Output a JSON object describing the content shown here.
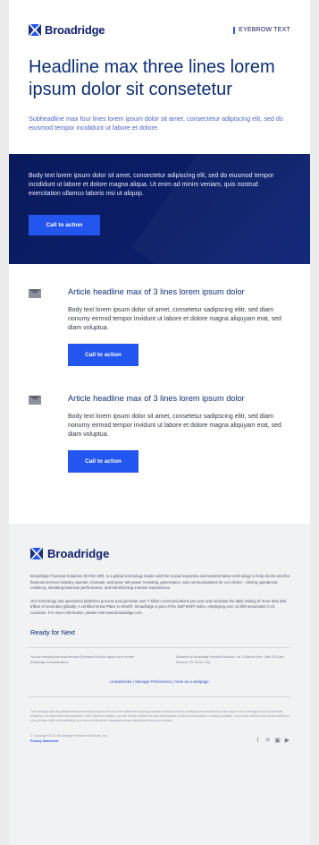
{
  "header": {
    "brand": "Broadridge",
    "eyebrow": "EYEBROW TEXT"
  },
  "headline": "Headline max three lines lorem ipsum dolor sit consetetur",
  "subheadline": "Subheadline max four lines lorem ipsum dolor sit amet, consectetur adipiscing elit, sed do eiusmod tempor incididunt ut labore et dolore.",
  "hero": {
    "body": "Body text lorem ipsum dolor sit amet, consectetur adipiscing elit, sed do eiusmod tempor incididunt ut labore et dolore magna aliqua. Ut enim ad minim veniam, quis nostrud exercitation ullamco laboris nisi ut aliquip.",
    "cta": "Call to action"
  },
  "articles": [
    {
      "icon": "envelope-icon",
      "title": "Article headline max of 3 lines lorem ipsum dolor",
      "body": "Body text lorem ipsum dolor sit amet, consetetur sadipscing elitr, sed diam nonumy eirmod tempor invidunt ut labore et dolore magna aliquyam erat, sed diam voluptua.",
      "cta": "Call to action"
    },
    {
      "icon": "envelope-icon",
      "title": "Article headline max of 3 lines lorem ipsum dolor",
      "body": "Body text lorem ipsum dolor sit amet, consetetur sadipscing elitr, sed diam nonumy eirmod tempor invidunt ut labore et dolore magna aliquyam erat, sed diam voluptua.",
      "cta": "Call to action"
    }
  ],
  "footer": {
    "brand": "Broadridge",
    "about": "Broadridge Financial Solutions (NYSE: BR), is a global technology leader with the trusted expertise and transformative technology to help clients and the financial services industry operate, innovate, and grow. We power investing, governance, and communications for our clients – driving operational resiliency, elevating business performance, and transforming investor experiences.",
    "about2": "Our technology and operations platforms process and generate over 7 billion communications per year and underpin the daily trading of more than $10 trillion of securities globally. A certified Great Place to Work®, Broadridge is part of the S&P 500® Index, employing over 14,000 associates in 21 countries. For more information, please visit www.broadridge.com.",
    "tagline": "Ready for Next",
    "col_left": "You are receiving this email because [Recipient Email] is signed up to receive Broadridge communications.",
    "col_right": "Delivered by Broadridge Financial Solutions, Inc. 5 Dakota Drive, Suite 300 Lake Success, NY 11042, USA",
    "unsubscribe": "Unsubscribe",
    "manage": "Manage Preferences",
    "webpage": "View as a webpage",
    "legal": "This message and any attachments are intended only for the use of the addressee and may contain information that is privileged and confidential. If the reader of the message is not the intended recipient or an authorized representative of the intended recipient, you are hereby notified that any dissemination of this communication is strictly prohibited. If you have received this communication in error, please notify us immediately by e-mail and delete the message and any attachments from your system.",
    "copyright": "© Copyright 2024. Broadridge Financial Solutions, Inc.",
    "privacy": "Privacy Statement",
    "social": [
      "facebook-icon",
      "twitter-icon",
      "linkedin-icon",
      "youtube-icon"
    ]
  },
  "colors": {
    "brand_navy": "#0b1e68",
    "accent_blue": "#2355ef",
    "headline_blue": "#0b2e74"
  }
}
